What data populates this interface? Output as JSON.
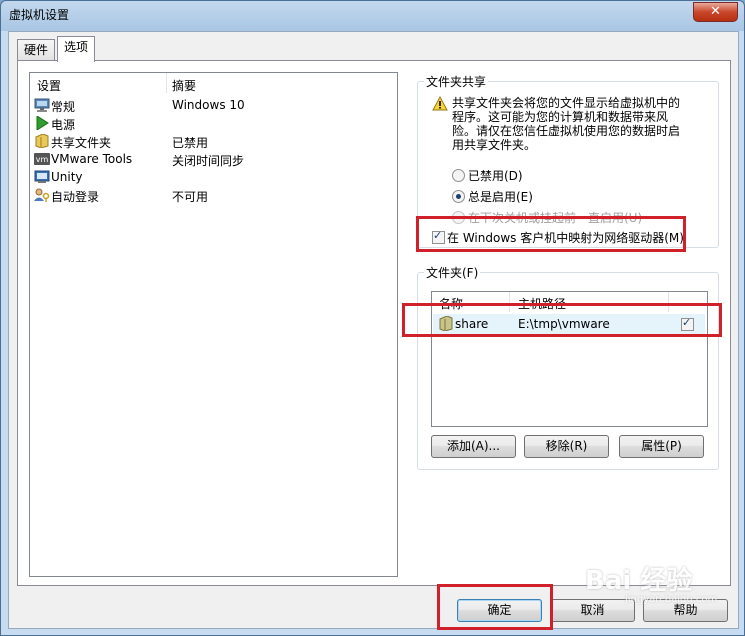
{
  "window": {
    "title": "虚拟机设置",
    "close_label": "✕"
  },
  "tabs": [
    {
      "label": "硬件"
    },
    {
      "label": "选项"
    }
  ],
  "settings_list": {
    "col_setting": "设置",
    "col_summary": "摘要",
    "items": [
      {
        "name": "常规",
        "summary": "Windows 10",
        "icon": "monitor-icon"
      },
      {
        "name": "电源",
        "summary": "",
        "icon": "play-icon"
      },
      {
        "name": "共享文件夹",
        "summary": "已禁用",
        "icon": "shared-folder-icon"
      },
      {
        "name": "VMware Tools",
        "summary": "关闭时间同步",
        "icon": "vmware-tools-icon"
      },
      {
        "name": "Unity",
        "summary": "",
        "icon": "unity-icon"
      },
      {
        "name": "自动登录",
        "summary": "不可用",
        "icon": "user-key-icon"
      }
    ]
  },
  "folder_sharing": {
    "group_title": "文件夹共享",
    "warning_text": "共享文件夹会将您的文件显示给虚拟机中的程序。这可能为您的计算机和数据带来风险。请仅在您信任虚拟机使用您的数据时启用共享文件夹。",
    "options": [
      {
        "label": "已禁用(D)",
        "selected": false,
        "enabled": true
      },
      {
        "label": "总是启用(E)",
        "selected": true,
        "enabled": true
      },
      {
        "label": "在下次关机或挂起前一直启用(U)",
        "selected": false,
        "enabled": false
      }
    ],
    "map_drive_label": "在 Windows 客户机中映射为网络驱动器(M)",
    "map_drive_checked": true
  },
  "folders": {
    "group_title": "文件夹(F)",
    "col_name": "名称",
    "col_path": "主机路径",
    "rows": [
      {
        "name": "share",
        "path": "E:\\tmp\\vmware",
        "enabled": true
      }
    ],
    "add_label": "添加(A)...",
    "remove_label": "移除(R)",
    "properties_label": "属性(P)"
  },
  "footer": {
    "ok_label": "确定",
    "cancel_label": "取消",
    "help_label": "帮助"
  },
  "watermark": {
    "text": "Bai 经验",
    "sub": "jingyan.baidu.com"
  },
  "colors": {
    "highlight": "#d0202a",
    "window_frame": "#a9c6e4",
    "selection": "#e5f3fb"
  }
}
